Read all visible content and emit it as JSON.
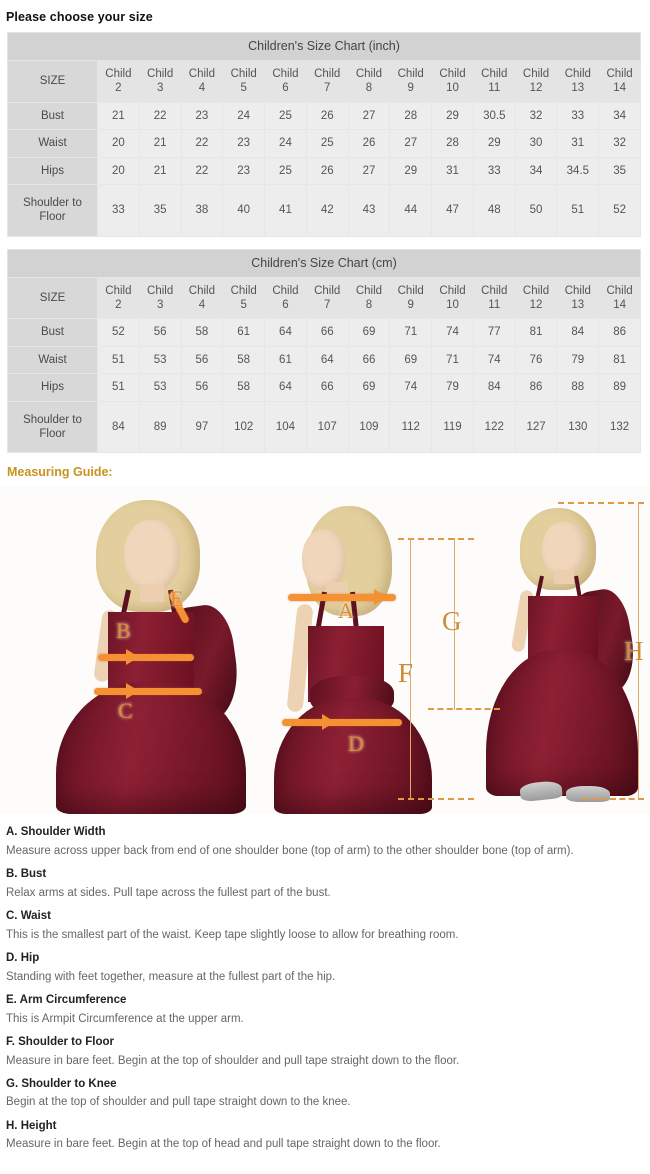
{
  "page_title": "Please choose your size",
  "tables": [
    {
      "title": "Children's Size Chart (inch)",
      "size_label": "SIZE",
      "columns": [
        "Child 2",
        "Child 3",
        "Child 4",
        "Child 5",
        "Child 6",
        "Child 7",
        "Child 8",
        "Child 9",
        "Child 10",
        "Child 11",
        "Child 12",
        "Child 13",
        "Child 14"
      ],
      "rows": [
        {
          "label": "Bust",
          "values": [
            "21",
            "22",
            "23",
            "24",
            "25",
            "26",
            "27",
            "28",
            "29",
            "30.5",
            "32",
            "33",
            "34"
          ]
        },
        {
          "label": "Waist",
          "values": [
            "20",
            "21",
            "22",
            "23",
            "24",
            "25",
            "26",
            "27",
            "28",
            "29",
            "30",
            "31",
            "32"
          ]
        },
        {
          "label": "Hips",
          "values": [
            "20",
            "21",
            "22",
            "23",
            "25",
            "26",
            "27",
            "29",
            "31",
            "33",
            "34",
            "34.5",
            "35"
          ]
        },
        {
          "label": "Shoulder to Floor",
          "values": [
            "33",
            "35",
            "38",
            "40",
            "41",
            "42",
            "43",
            "44",
            "47",
            "48",
            "50",
            "51",
            "52"
          ]
        }
      ]
    },
    {
      "title": "Children's Size Chart (cm)",
      "size_label": "SIZE",
      "columns": [
        "Child 2",
        "Child 3",
        "Child 4",
        "Child 5",
        "Child 6",
        "Child 7",
        "Child 8",
        "Child 9",
        "Child 10",
        "Child 11",
        "Child 12",
        "Child 13",
        "Child 14"
      ],
      "rows": [
        {
          "label": "Bust",
          "values": [
            "52",
            "56",
            "58",
            "61",
            "64",
            "66",
            "69",
            "71",
            "74",
            "77",
            "81",
            "84",
            "86"
          ]
        },
        {
          "label": "Waist",
          "values": [
            "51",
            "53",
            "56",
            "58",
            "61",
            "64",
            "66",
            "69",
            "71",
            "74",
            "76",
            "79",
            "81"
          ]
        },
        {
          "label": "Hips",
          "values": [
            "51",
            "53",
            "56",
            "58",
            "64",
            "66",
            "69",
            "74",
            "79",
            "84",
            "86",
            "88",
            "89"
          ]
        },
        {
          "label": "Shoulder to Floor",
          "values": [
            "84",
            "89",
            "97",
            "102",
            "104",
            "107",
            "109",
            "112",
            "119",
            "122",
            "127",
            "130",
            "132"
          ]
        }
      ]
    }
  ],
  "measuring_guide_title": "Measuring Guide:",
  "figure_markers": {
    "a": "A",
    "b": "B",
    "c": "C",
    "d": "D",
    "e": "E",
    "f": "F",
    "g": "G",
    "h": "H"
  },
  "guide_items": [
    {
      "term": "A. Shoulder Width",
      "desc": "Measure across upper back from end of one shoulder bone (top of arm) to the other shoulder bone (top of arm)."
    },
    {
      "term": "B. Bust",
      "desc": "Relax arms at sides. Pull tape across the fullest part of the bust."
    },
    {
      "term": "C. Waist",
      "desc": "This is the smallest part of the waist. Keep tape slightly loose to allow for breathing room."
    },
    {
      "term": "D. Hip",
      "desc": "Standing with feet together, measure at the fullest part of the hip."
    },
    {
      "term": "E. Arm Circumference",
      "desc": "This is Armpit Circumference at the upper arm."
    },
    {
      "term": "F. Shoulder to Floor",
      "desc": "Measure in bare feet. Begin at the top of shoulder and pull tape straight down to the floor."
    },
    {
      "term": "G. Shoulder to Knee",
      "desc": "Begin at the top of shoulder and pull tape straight down to the knee."
    },
    {
      "term": "H. Height",
      "desc": "Measure in bare feet. Begin at the top of head and pull tape straight down to the floor."
    }
  ],
  "colors": {
    "accent": "#c8921f",
    "tape": "#f59033",
    "marker": "#cd8c33",
    "dress": "#8d1f33",
    "table_title_bg": "#d2d2d2",
    "table_head_bg": "#d8d8d8",
    "table_cell_bg": "#ededed"
  }
}
